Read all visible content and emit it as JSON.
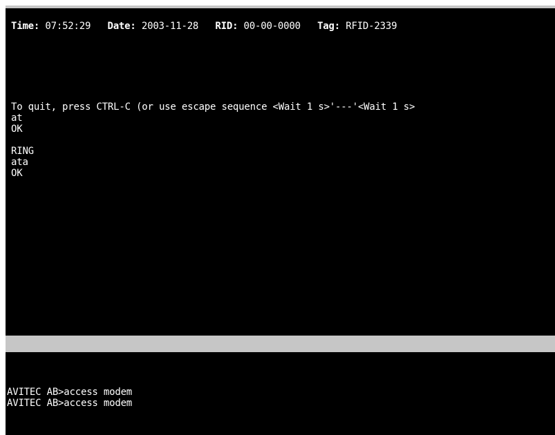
{
  "status_bar": {
    "time_label": "Time:",
    "time_value": "07:52:29",
    "date_label": "Date:",
    "date_value": "2003-11-28",
    "rid_label": "RID:",
    "rid_value": "00-00-0000",
    "tag_label": "Tag:",
    "tag_value": "RFID-2339"
  },
  "terminal_output": [
    "To quit, press CTRL-C (or use escape sequence <Wait 1 s>'---'<Wait 1 s>",
    "at",
    "OK",
    "",
    "RING",
    "ata",
    "OK"
  ],
  "command_history": [
    "AVITEC AB>access modem",
    "AVITEC AB>access modem"
  ],
  "colors": {
    "background": "#000000",
    "text": "#ffffff",
    "divider": "#c6c6c6"
  }
}
